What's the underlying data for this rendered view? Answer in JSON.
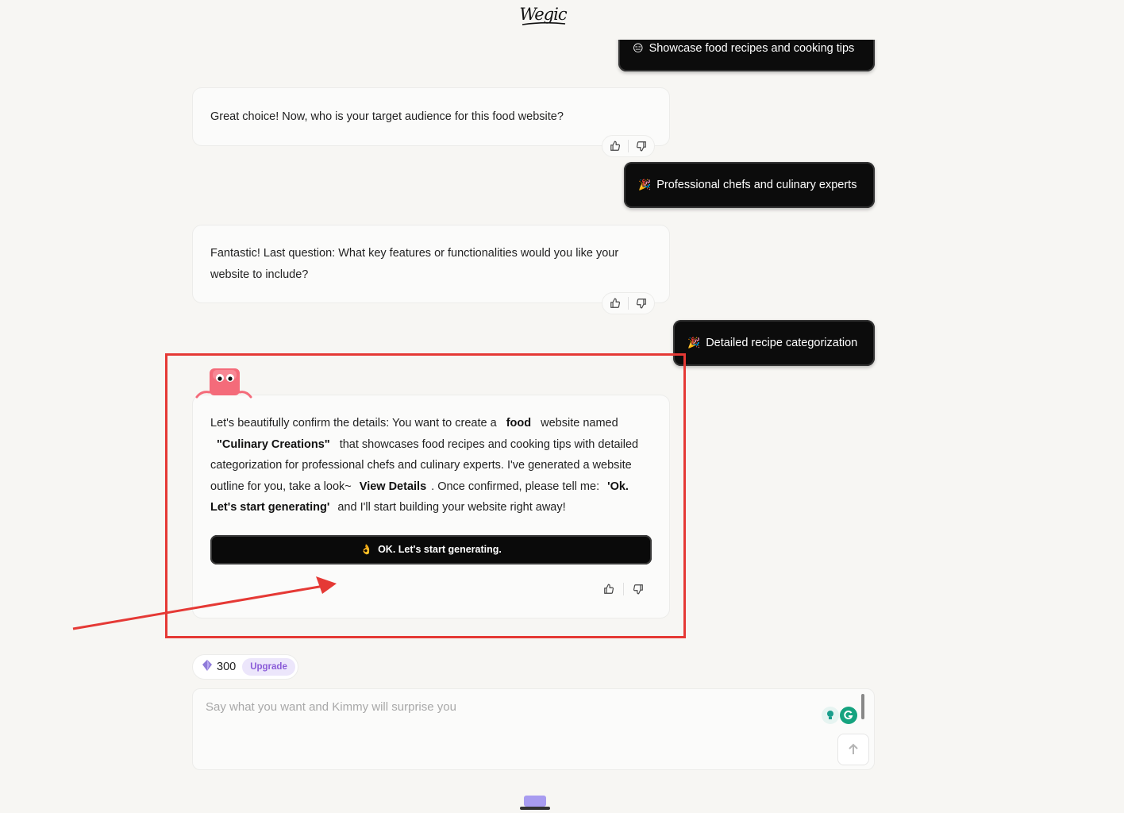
{
  "app": {
    "logo_text": "Wegic"
  },
  "messages": {
    "user_partial": {
      "emoji": "😑",
      "text": "Showcase food recipes and cooking tips"
    },
    "bot_audience": {
      "text": "Great choice! Now, who is your target audience for this food website?"
    },
    "user_audience": {
      "emoji": "🎉",
      "text": "Professional chefs and culinary experts"
    },
    "bot_features": {
      "text": "Fantastic! Last question: What key features or functionalities would you like your website to include?"
    },
    "user_features": {
      "emoji": "🎉",
      "text": "Detailed recipe categorization"
    },
    "bot_confirm": {
      "t1": "Let's beautifully confirm the details: You want to create a ",
      "b1": "food",
      "t2": " website named ",
      "b2": "\"Culinary Creations\"",
      "t3": " that showcases food recipes and cooking tips with detailed categorization for professional chefs and culinary experts. I've generated a website outline for you, take a look~ ",
      "b3": "View Details",
      "t4": ". Once confirmed, please tell me: ",
      "b4": "'Ok. Let's start generating'",
      "t5": " and I'll start building your website right away!",
      "cta_emoji": "👌",
      "cta_label": "OK. Let's start generating."
    }
  },
  "credits": {
    "amount": "300",
    "upgrade_label": "Upgrade"
  },
  "input": {
    "placeholder": "Say what you want and Kimmy will surprise you",
    "value": ""
  },
  "colors": {
    "annotation": "#e53935",
    "user_bubble_bg": "#0c0c0c",
    "upgrade_text": "#8a5bd8"
  },
  "icons": [
    "thumbs-up-icon",
    "thumbs-down-icon",
    "send-arrow-icon",
    "mascot-icon",
    "gem-icon",
    "grammar-extension-icon",
    "lightbulb-extension-icon"
  ]
}
